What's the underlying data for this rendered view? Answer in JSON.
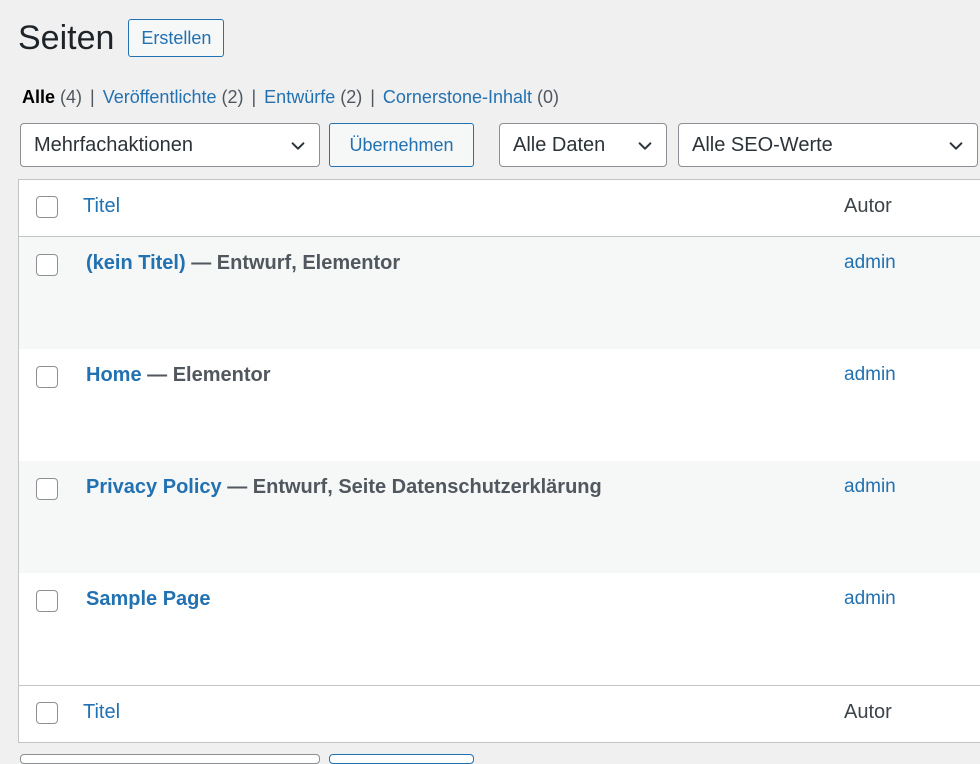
{
  "header": {
    "title": "Seiten",
    "create_button": "Erstellen"
  },
  "filters": {
    "all": {
      "label": "Alle",
      "count": "(4)"
    },
    "published": {
      "label": "Veröffentlichte",
      "count": "(2)"
    },
    "drafts": {
      "label": "Entwürfe",
      "count": "(2)"
    },
    "cornerstone": {
      "label": "Cornerstone-Inhalt",
      "count": "(0)"
    },
    "separator": "|"
  },
  "tablenav": {
    "bulk_actions": "Mehrfachaktionen",
    "apply_button": "Übernehmen",
    "dates": "Alle Daten",
    "seo": "Alle SEO-Werte"
  },
  "table": {
    "columns": {
      "title": "Titel",
      "author": "Autor"
    },
    "rows": [
      {
        "title": "(kein Titel)",
        "state": " — Entwurf, Elementor",
        "author": "admin"
      },
      {
        "title": "Home",
        "state": " — Elementor",
        "author": "admin"
      },
      {
        "title": "Privacy Policy",
        "state": " — Entwurf, Seite Datenschutzerklärung",
        "author": "admin"
      },
      {
        "title": "Sample Page",
        "state": "",
        "author": "admin"
      }
    ]
  },
  "colors": {
    "link": "#2271b1",
    "background": "#f0f0f1",
    "border": "#c3c4c7"
  }
}
